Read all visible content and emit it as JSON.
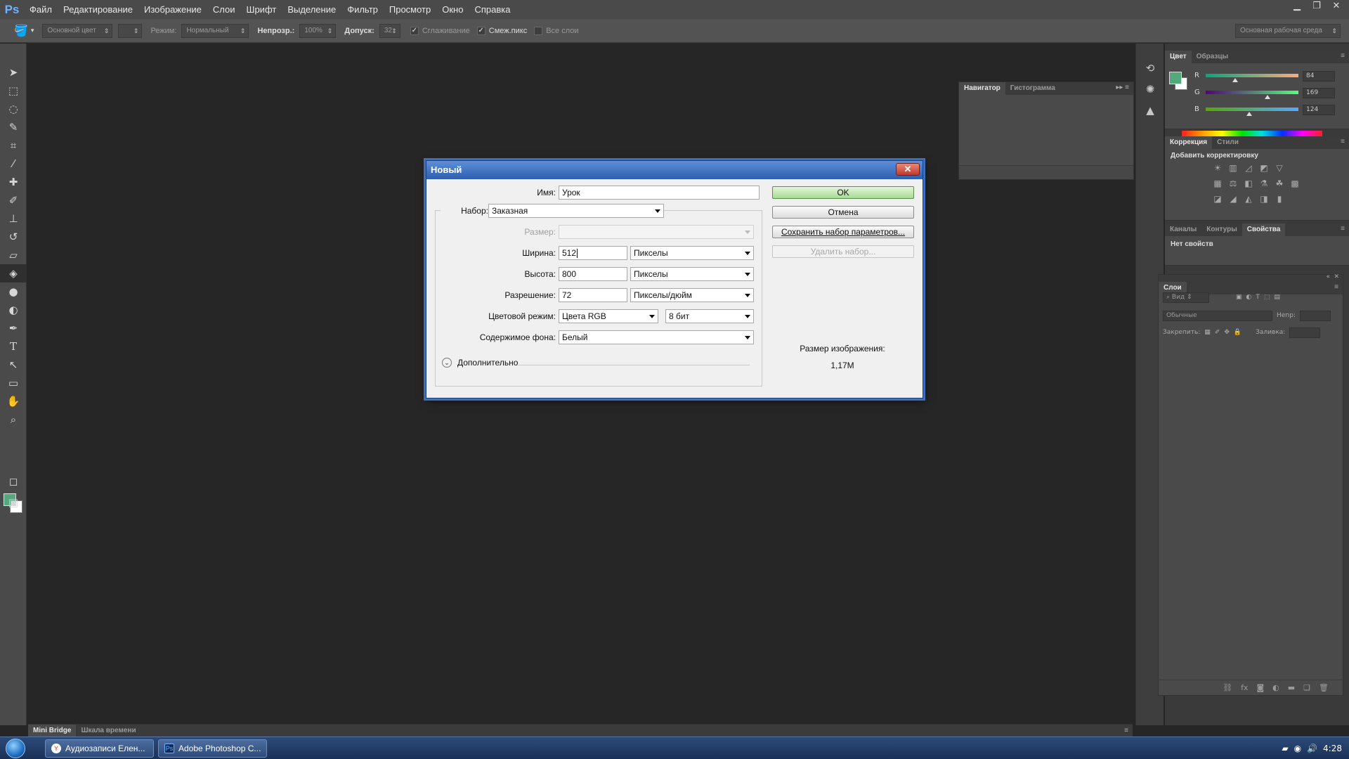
{
  "app": {
    "logo": "Ps",
    "menu": [
      "Файл",
      "Редактирование",
      "Изображение",
      "Слои",
      "Шрифт",
      "Выделение",
      "Фильтр",
      "Просмотр",
      "Окно",
      "Справка"
    ]
  },
  "options_bar": {
    "fill_source": "Основной цвет",
    "mode_label": "Режим:",
    "mode_value": "Нормальный",
    "opacity_label": "Непрозр.:",
    "opacity_value": "100%",
    "tolerance_label": "Допуск:",
    "tolerance_value": "32",
    "antialias_label": "Сглаживание",
    "contiguous_label": "Смеж.пикс",
    "all_layers_label": "Все слои",
    "workspace": "Основная рабочая среда"
  },
  "navigator_panel": {
    "tabs": [
      "Навигатор",
      "Гистограмма"
    ]
  },
  "color_panel": {
    "tabs": [
      "Цвет",
      "Образцы"
    ],
    "r_label": "R",
    "r_value": "84",
    "g_label": "G",
    "g_value": "169",
    "b_label": "B",
    "b_value": "124",
    "foreground_color": "#54a97c"
  },
  "adjustments_panel": {
    "tabs": [
      "Коррекция",
      "Стили"
    ],
    "title": "Добавить корректировку"
  },
  "properties_panel": {
    "tabs": [
      "Каналы",
      "Контуры",
      "Свойства"
    ],
    "empty_text": "Нет свойств"
  },
  "layers_panel": {
    "tab": "Слои",
    "filter_label": "Вид",
    "blend_mode": "Обычные",
    "opacity_label": "Непр:",
    "lock_label": "Закрепить:",
    "fill_label": "Заливка:"
  },
  "bottom_bar": {
    "tabs": [
      "Mini Bridge",
      "Шкала времени"
    ]
  },
  "dialog": {
    "title": "Новый",
    "close": "✕",
    "name_label": "Имя:",
    "name_value": "Урок",
    "preset_label": "Набор:",
    "preset_value": "Заказная",
    "size_label": "Размер:",
    "size_value": "",
    "width_label": "Ширина:",
    "width_value": "512",
    "width_unit": "Пикселы",
    "height_label": "Высота:",
    "height_value": "800",
    "height_unit": "Пикселы",
    "resolution_label": "Разрешение:",
    "resolution_value": "72",
    "resolution_unit": "Пикселы/дюйм",
    "color_mode_label": "Цветовой режим:",
    "color_mode_value": "Цвета RGB",
    "bit_depth_value": "8 бит",
    "background_label": "Содержимое фона:",
    "background_value": "Белый",
    "advanced_label": "Дополнительно",
    "ok_label": "OK",
    "cancel_label": "Отмена",
    "save_preset_label": "Сохранить набор параметров...",
    "delete_preset_label": "Удалить набор...",
    "image_size_label": "Размер изображения:",
    "image_size_value": "1,17M"
  },
  "taskbar": {
    "items": [
      {
        "label": "Аудиозаписи Елен...",
        "icon": "yandex-browser-icon"
      },
      {
        "label": "Adobe Photoshop C...",
        "icon": "photoshop-icon"
      }
    ],
    "clock": "4:28"
  }
}
